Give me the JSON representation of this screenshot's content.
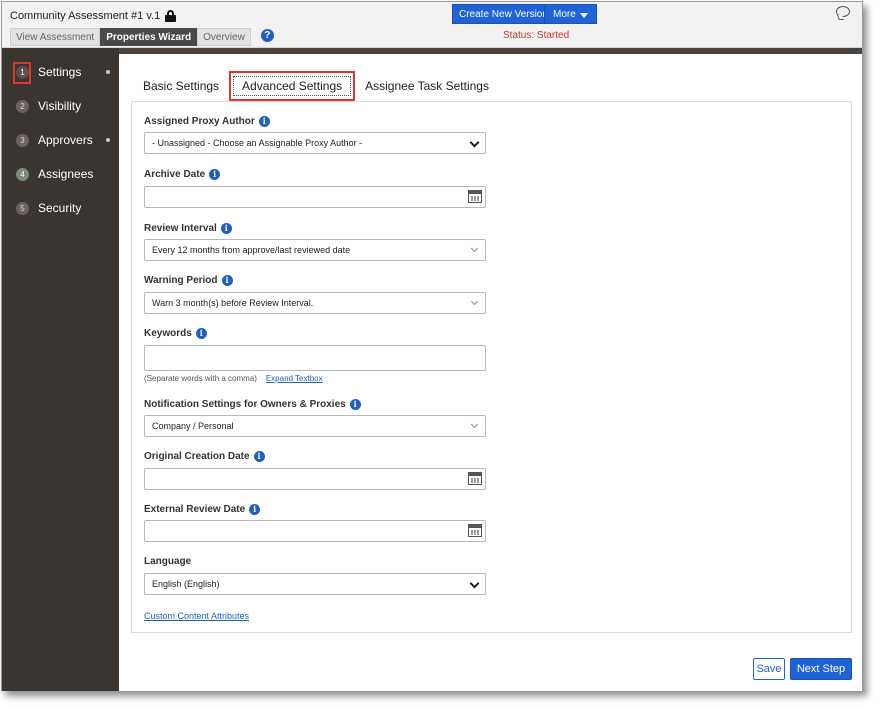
{
  "header": {
    "title": "Community Assessment #1 v.1",
    "tabs": [
      {
        "label": "View Assessment"
      },
      {
        "label": "Properties Wizard"
      },
      {
        "label": "Overview"
      }
    ],
    "create_version_label": "Create New Version",
    "more_label": "More",
    "status": "Status: Started"
  },
  "sidebar": {
    "steps": [
      {
        "num": "1",
        "label": "Settings"
      },
      {
        "num": "2",
        "label": "Visibility"
      },
      {
        "num": "3",
        "label": "Approvers"
      },
      {
        "num": "4",
        "label": "Assignees"
      },
      {
        "num": "5",
        "label": "Security"
      }
    ]
  },
  "subtabs": {
    "basic": "Basic Settings",
    "advanced": "Advanced Settings",
    "assignee": "Assignee Task Settings"
  },
  "form": {
    "proxy_author": {
      "label": "Assigned Proxy Author",
      "value": "- Unassigned - Choose an Assignable Proxy Author -"
    },
    "archive_date": {
      "label": "Archive Date",
      "value": ""
    },
    "review_interval": {
      "label": "Review Interval",
      "value": "Every 12 months from approve/last reviewed date"
    },
    "warning_period": {
      "label": "Warning Period",
      "value": "Warn 3 month(s) before Review Interval."
    },
    "keywords": {
      "label": "Keywords",
      "value": "",
      "hint": "(Separate words with a comma)",
      "expand_link": "Expand Textbox"
    },
    "notification": {
      "label": "Notification Settings for Owners & Proxies",
      "value": "Company / Personal"
    },
    "original_creation_date": {
      "label": "Original Creation Date",
      "value": ""
    },
    "external_review_date": {
      "label": "External Review Date",
      "value": ""
    },
    "language": {
      "label": "Language",
      "value": "English (English)"
    },
    "custom_attributes_link": "Custom Content Attributes"
  },
  "footer": {
    "save_label": "Save",
    "next_label": "Next Step"
  },
  "colors": {
    "accent": "#1f63d6",
    "sidebar_bg": "#3b3532",
    "highlight": "#e23232",
    "status": "#c0392b"
  }
}
